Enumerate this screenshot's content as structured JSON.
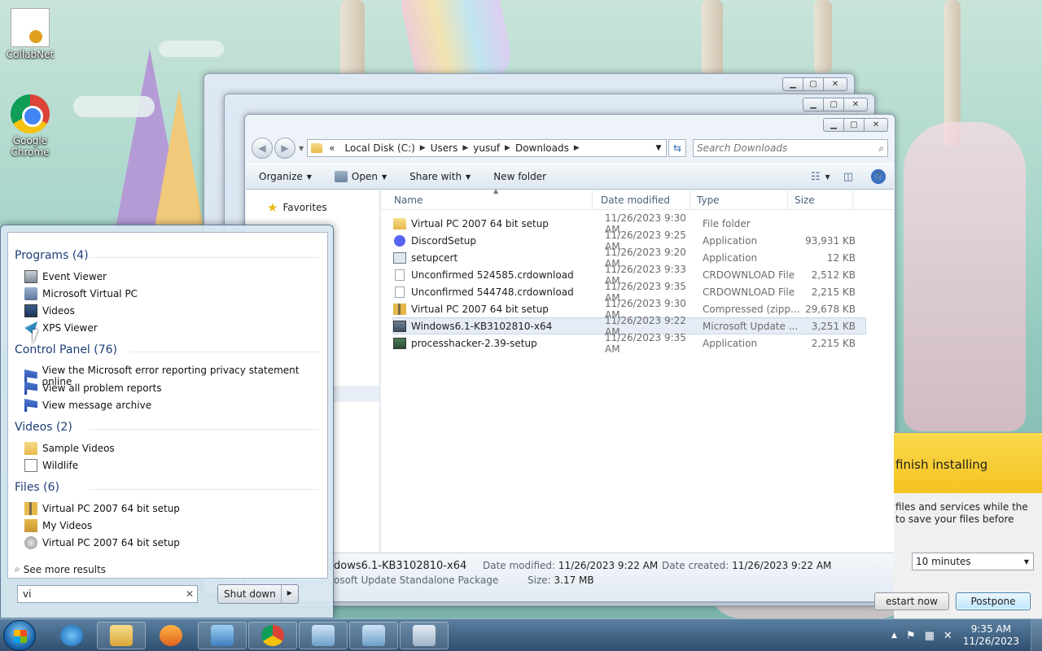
{
  "desktop": {
    "icons": [
      {
        "label": "CollabNet",
        "icon": "certificate-icon"
      },
      {
        "label": "Google Chrome",
        "icon": "chrome-icon"
      }
    ]
  },
  "explorer": {
    "address": {
      "overflow": "«",
      "crumbs": [
        "Local Disk (C:)",
        "Users",
        "yusuf",
        "Downloads"
      ]
    },
    "search_placeholder": "Search Downloads",
    "commands": {
      "organize": "Organize",
      "open": "Open",
      "share_with": "Share with",
      "new_folder": "New folder"
    },
    "nav": {
      "favorites": "Favorites"
    },
    "columns": {
      "name": "Name",
      "date": "Date modified",
      "type": "Type",
      "size": "Size"
    },
    "files": [
      {
        "name": "Virtual PC 2007 64 bit setup",
        "date": "11/26/2023 9:30 AM",
        "type": "File folder",
        "size": "",
        "icon": "folder"
      },
      {
        "name": "DiscordSetup",
        "date": "11/26/2023 9:25 AM",
        "type": "Application",
        "size": "93,931 KB",
        "icon": "discord"
      },
      {
        "name": "setupcert",
        "date": "11/26/2023 9:20 AM",
        "type": "Application",
        "size": "12 KB",
        "icon": "app"
      },
      {
        "name": "Unconfirmed 524585.crdownload",
        "date": "11/26/2023 9:33 AM",
        "type": "CRDOWNLOAD File",
        "size": "2,512 KB",
        "icon": "doc"
      },
      {
        "name": "Unconfirmed 544748.crdownload",
        "date": "11/26/2023 9:35 AM",
        "type": "CRDOWNLOAD File",
        "size": "2,215 KB",
        "icon": "doc"
      },
      {
        "name": "Virtual PC 2007 64 bit setup",
        "date": "11/26/2023 9:30 AM",
        "type": "Compressed (zipp...",
        "size": "29,678 KB",
        "icon": "zip"
      },
      {
        "name": "Windows6.1-KB3102810-x64",
        "date": "11/26/2023 9:22 AM",
        "type": "Microsoft Update ...",
        "size": "3,251 KB",
        "icon": "msu",
        "selected": true
      },
      {
        "name": "processhacker-2.39-setup",
        "date": "11/26/2023 9:35 AM",
        "type": "Application",
        "size": "2,215 KB",
        "icon": "ph"
      }
    ],
    "details": {
      "name": "dows6.1-KB3102810-x64",
      "type": "osoft Update Standalone Package",
      "date_modified_label": "Date modified:",
      "date_modified": "11/26/2023 9:22 AM",
      "date_created_label": "Date created:",
      "date_created": "11/26/2023 9:22 AM",
      "size_label": "Size:",
      "size": "3.17 MB"
    }
  },
  "update_dialog": {
    "heading": "finish installing",
    "text_line1": "files and services while the",
    "text_line2": "to save your files before",
    "delay_value": "10 minutes",
    "restart_label": "estart now",
    "postpone_label": "Postpone"
  },
  "start_menu": {
    "groups": [
      {
        "title": "Programs (4)",
        "items": [
          {
            "label": "Event Viewer",
            "icon": "i-ev"
          },
          {
            "label": "Microsoft Virtual PC",
            "icon": "i-vpc"
          },
          {
            "label": "Videos",
            "icon": "i-vid"
          },
          {
            "label": "XPS Viewer",
            "icon": "i-xps"
          }
        ]
      },
      {
        "title": "Control Panel (76)",
        "items": [
          {
            "label": "View the Microsoft error reporting privacy statement online",
            "icon": "i-flag"
          },
          {
            "label": "View all problem reports",
            "icon": "i-flag"
          },
          {
            "label": "View message archive",
            "icon": "i-flag"
          }
        ]
      },
      {
        "title": "Videos (2)",
        "items": [
          {
            "label": "Sample Videos",
            "icon": "i-folder"
          },
          {
            "label": "Wildlife",
            "icon": "i-wild"
          }
        ]
      },
      {
        "title": "Files (6)",
        "items": [
          {
            "label": "Virtual PC 2007 64 bit setup",
            "icon": "i-zip"
          },
          {
            "label": "My Videos",
            "icon": "i-myv"
          },
          {
            "label": "Virtual PC 2007 64 bit setup",
            "icon": "i-disk"
          }
        ]
      }
    ],
    "see_more": "See more results",
    "search_value": "vi",
    "shutdown_label": "Shut down"
  },
  "taskbar": {
    "time": "9:35 AM",
    "date": "11/26/2023"
  },
  "colors": {
    "accent": "#1e3f79",
    "update_banner": "#f5c320"
  }
}
